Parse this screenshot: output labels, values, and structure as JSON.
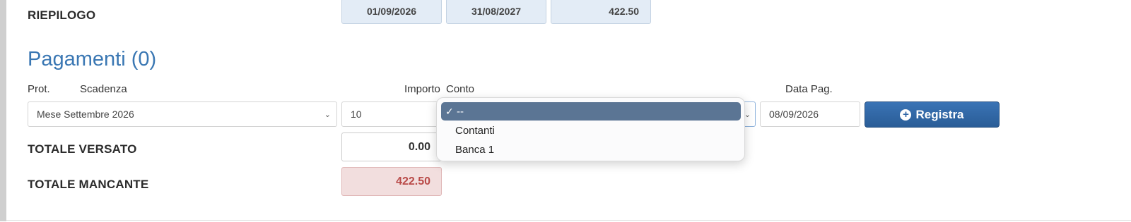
{
  "riepilogo": {
    "label": "RIEPILOGO",
    "date_from": "01/09/2026",
    "date_to": "31/08/2027",
    "amount": "422.50"
  },
  "pagamenti": {
    "title": "Pagamenti (0)",
    "columns": {
      "prot": "Prot.",
      "scadenza": "Scadenza",
      "importo": "Importo",
      "conto": "Conto",
      "data_pag": "Data Pag."
    },
    "form": {
      "scadenza_value": "Mese Settembre 2026",
      "importo_value": "10",
      "data_pag_value": "08/09/2026",
      "registra_label": "Registra"
    },
    "conto_dropdown": {
      "selected": "--",
      "options": [
        "--",
        "Contanti",
        "Banca 1"
      ]
    }
  },
  "totali": {
    "versato_label": "TOTALE VERSATO",
    "versato_value": "0.00",
    "mancante_label": "TOTALE MANCANTE",
    "mancante_value": "422.50"
  },
  "icons": {
    "check": "check-icon",
    "plus": "plus-circle-icon",
    "chevron": "chevron-down-icon"
  },
  "colors": {
    "title_blue": "#3a77b3",
    "button_blue": "#2f66a6",
    "alert_red": "#b94a48",
    "alert_bg": "#f2dede",
    "summary_bg": "#e3ecf6",
    "dropdown_selected": "#5b7594"
  }
}
